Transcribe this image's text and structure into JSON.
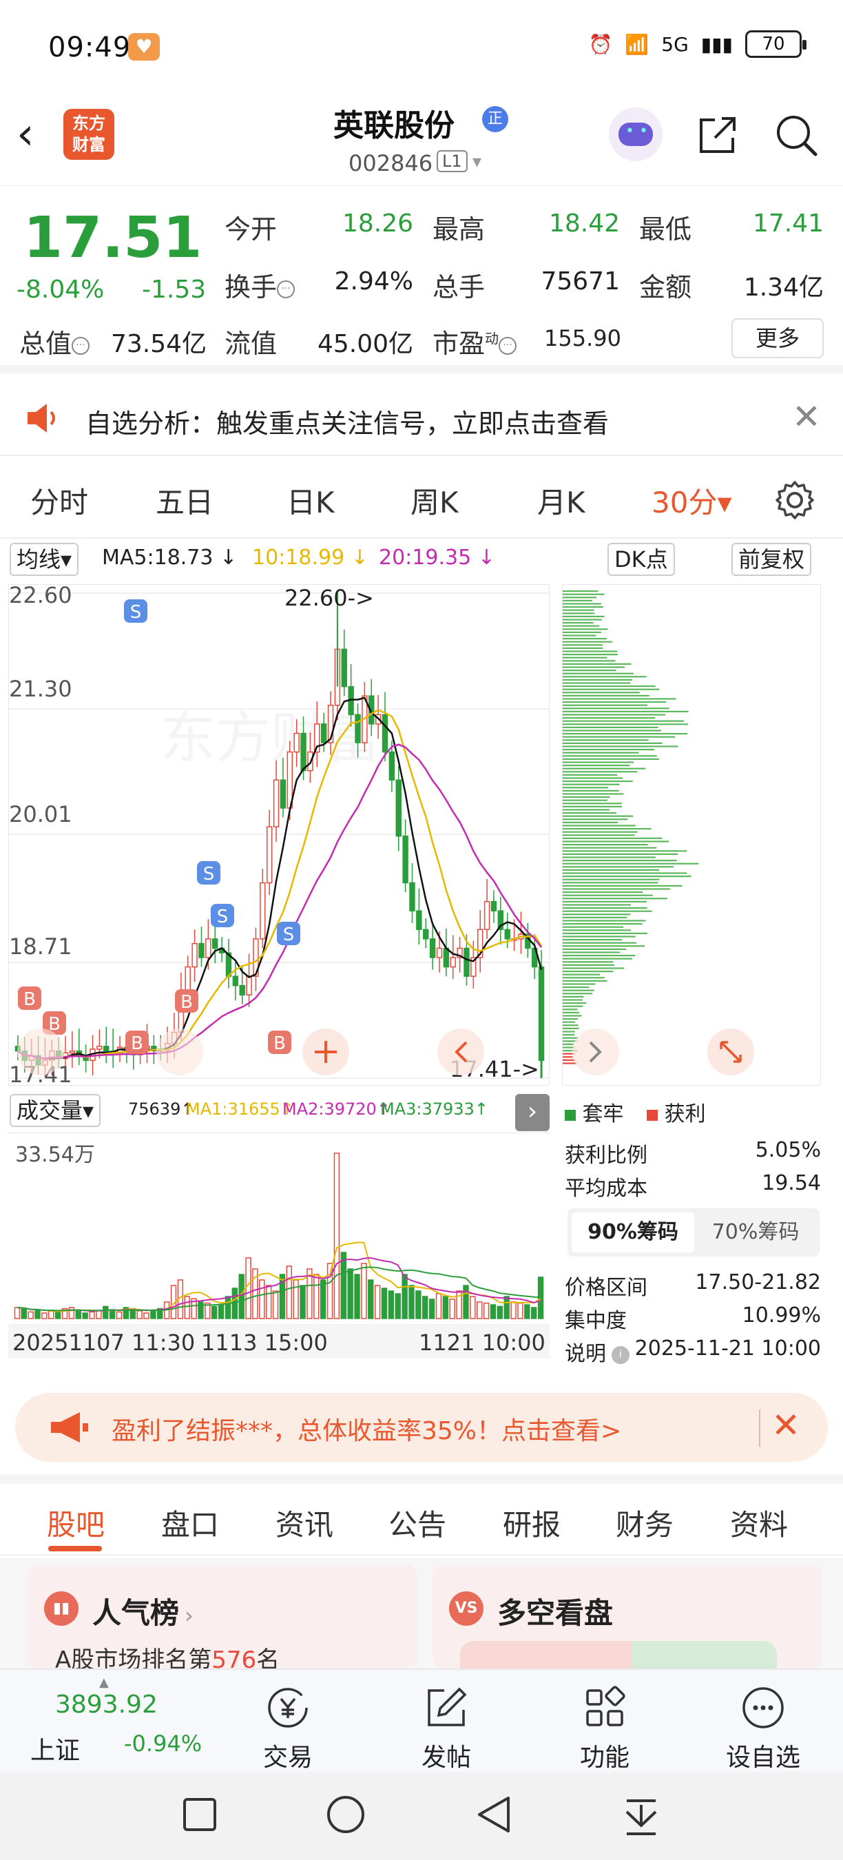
{
  "status": {
    "time": "09:49",
    "battery": "70",
    "signal_text": "5G"
  },
  "header": {
    "stock_name": "英联股份",
    "stock_tag": "正",
    "stock_code": "002846",
    "level": "L1",
    "brand": "东方\n财富"
  },
  "quote": {
    "price": "17.51",
    "change_pct": "-8.04%",
    "change": "-1.53",
    "open_label": "今开",
    "open": "18.26",
    "high_label": "最高",
    "high": "18.42",
    "low_label": "最低",
    "low": "17.41",
    "turnover_label": "换手",
    "turnover": "2.94%",
    "volume_label": "总手",
    "volume": "75671",
    "amount_label": "金额",
    "amount": "1.34亿",
    "mcap_label": "总值",
    "mcap": "73.54亿",
    "float_label": "流值",
    "float": "45.00亿",
    "pe_label": "市盈",
    "pe_sup": "动",
    "pe": "155.90",
    "more": "更多"
  },
  "notice": {
    "text": "自选分析：触发重点关注信号，立即点击查看"
  },
  "period_tabs": [
    "分时",
    "五日",
    "日K",
    "周K",
    "月K",
    "30分▾"
  ],
  "ma_bar": {
    "indicator": "均线▾",
    "ma5": "MA5:18.73 ↓",
    "ma10": "10:18.99 ↓",
    "ma20": "20:19.35 ↓",
    "dk": "DK点",
    "adjust": "前复权"
  },
  "kchart": {
    "y_labels": [
      "22.60",
      "21.30",
      "20.01",
      "18.71",
      "17.41"
    ],
    "max_label": "22.60->",
    "min_label": "17.41->",
    "signals": [
      "S",
      "S",
      "S",
      "S",
      "B",
      "B",
      "B",
      "B",
      "B"
    ]
  },
  "volume": {
    "indicator": "成交量▾",
    "vol": "75639↑",
    "ma1": "MA1:31655↑",
    "ma2": "MA2:39720↑",
    "ma3": "MA3:37933↑",
    "max_label": "33.54万"
  },
  "time_axis": [
    "20251107 11:30",
    "1113 15:00",
    "1121 10:00"
  ],
  "chips": {
    "legend_trapped": "套牢",
    "legend_profit": "获利",
    "profit_ratio_label": "获利比例",
    "profit_ratio": "5.05%",
    "avg_cost_label": "平均成本",
    "avg_cost": "19.54",
    "tab_90": "90%筹码",
    "tab_70": "70%筹码",
    "range_label": "价格区间",
    "range": "17.50-21.82",
    "concentration_label": "集中度",
    "concentration": "10.99%",
    "note_label": "说明",
    "note_time": "2025-11-21 10:00"
  },
  "ad": {
    "text": "盈利了结振***，总体收益率35%！点击查看>"
  },
  "content_tabs": [
    "股吧",
    "盘口",
    "资讯",
    "公告",
    "研报",
    "财务",
    "资料"
  ],
  "cards": {
    "left_title": "人气榜",
    "left_sub_prefix": "A股市场排名第",
    "left_rank": "576",
    "left_sub_suffix": "名",
    "right_title": "多空看盘"
  },
  "bottom_nav": {
    "index_value": "3893.92",
    "index_name": "上证",
    "index_pct": "-0.94%",
    "items": [
      "交易",
      "发帖",
      "功能",
      "设自选"
    ]
  },
  "colors": {
    "up": "#e8473a",
    "down": "#2b9e3c",
    "accent": "#e8572d",
    "ma10": "#e6b800",
    "ma20": "#c42bb1"
  }
}
